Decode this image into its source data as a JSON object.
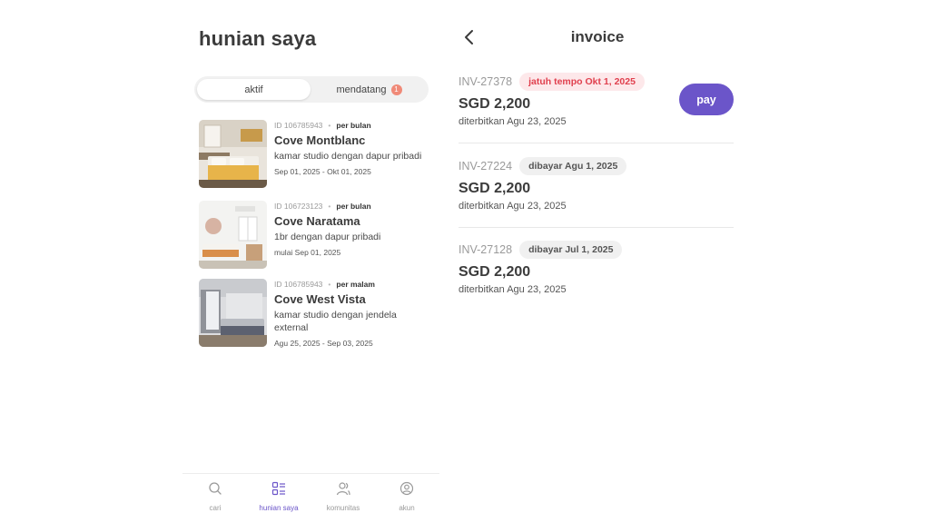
{
  "left": {
    "title": "hunian saya",
    "tabs": {
      "active": "aktif",
      "upcoming": "mendatang",
      "upcoming_count": "1"
    },
    "listings": [
      {
        "id": "ID 106785943",
        "period": "per bulan",
        "name": "Cove Montblanc",
        "desc": "kamar studio dengan dapur pribadi",
        "dates": "Sep 01, 2025 - Okt 01, 2025"
      },
      {
        "id": "ID 106723123",
        "period": "per bulan",
        "name": "Cove Naratama",
        "desc": "1br dengan dapur pribadi",
        "dates": "mulai Sep 01, 2025"
      },
      {
        "id": "ID 106785943",
        "period": "per malam",
        "name": "Cove West Vista",
        "desc": "kamar studio dengan jendela external",
        "dates": "Agu 25, 2025 - Sep 03, 2025"
      }
    ],
    "nav": [
      {
        "label": "cari",
        "icon": "search-icon"
      },
      {
        "label": "hunian saya",
        "icon": "list-icon"
      },
      {
        "label": "komunitas",
        "icon": "people-icon"
      },
      {
        "label": "akun",
        "icon": "account-icon"
      }
    ]
  },
  "right": {
    "title": "invoice",
    "invoices": [
      {
        "id": "INV-27378",
        "tag": "jatuh tempo Okt 1, 2025",
        "status": "due",
        "amount": "SGD 2,200",
        "issued": "diterbitkan Agu 23, 2025",
        "action": "pay"
      },
      {
        "id": "INV-27224",
        "tag": "dibayar Agu 1, 2025",
        "status": "paid",
        "amount": "SGD 2,200",
        "issued": "diterbitkan Agu 23, 2025"
      },
      {
        "id": "INV-27128",
        "tag": "dibayar Jul 1, 2025",
        "status": "paid",
        "amount": "SGD 2,200",
        "issued": "diterbitkan Agu 23, 2025"
      }
    ]
  },
  "colors": {
    "accent": "#6b55c9",
    "due_text": "#e0404e",
    "due_bg": "#fde8ea",
    "badge": "#f08a78"
  }
}
